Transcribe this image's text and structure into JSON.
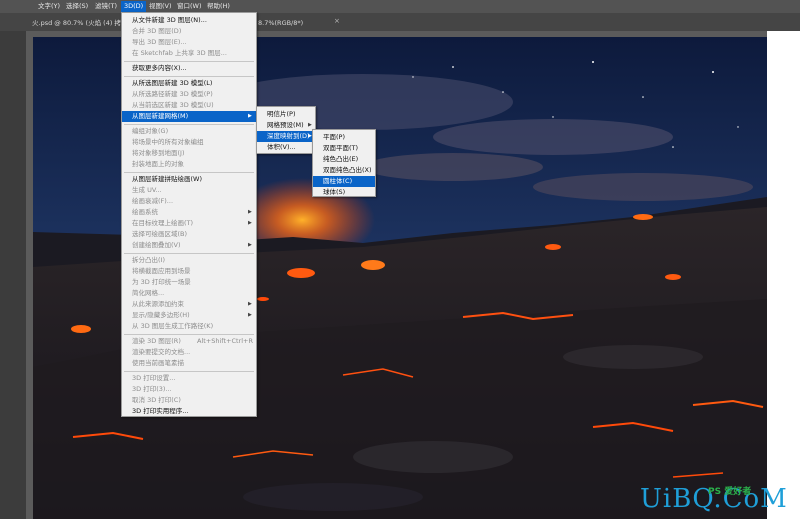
{
  "menubar": {
    "items": [
      "文字(Y)",
      "选择(S)",
      "滤镜(T)",
      "3D(D)",
      "视图(V)",
      "窗口(W)",
      "帮助(H)"
    ]
  },
  "tab": {
    "title": "火.psd @ 80.7% (火焰 (4) 拷",
    "title_tail": "8.7%(RGB/8*)",
    "close": "×"
  },
  "menu_3d": {
    "items": [
      {
        "label": "从文件新建 3D 图层(N)...",
        "disabled": false
      },
      {
        "label": "合并 3D 图层(D)",
        "disabled": true
      },
      {
        "label": "导出 3D 图层(E)...",
        "disabled": true
      },
      {
        "label": "在 Sketchfab 上共享 3D 图层...",
        "disabled": true
      },
      {
        "label": "获取更多内容(X)...",
        "disabled": false
      },
      {
        "label": "从所选图层新建 3D 模型(L)",
        "disabled": false
      },
      {
        "label": "从所选路径新建 3D 模型(P)",
        "disabled": true
      },
      {
        "label": "从当前选区新建 3D 模型(U)",
        "disabled": true
      },
      {
        "label": "从图层新建网格(M)",
        "disabled": false,
        "highlighted": true,
        "submenu": true
      },
      {
        "label": "编组对象(G)",
        "disabled": true
      },
      {
        "label": "将场景中的所有对象编组",
        "disabled": true
      },
      {
        "label": "将对象移到地面(J)",
        "disabled": true
      },
      {
        "label": "封装地面上的对象",
        "disabled": true
      },
      {
        "label": "从图层新建拼贴绘画(W)",
        "disabled": false
      },
      {
        "label": "生成 UV...",
        "disabled": true
      },
      {
        "label": "绘画衰减(F)...",
        "disabled": true
      },
      {
        "label": "绘画系统",
        "disabled": true,
        "submenu": true
      },
      {
        "label": "在目标纹理上绘画(T)",
        "disabled": true,
        "submenu": true
      },
      {
        "label": "选择可绘画区域(B)",
        "disabled": true
      },
      {
        "label": "创建绘图叠加(V)",
        "disabled": true,
        "submenu": true
      },
      {
        "label": "拆分凸出(I)",
        "disabled": true
      },
      {
        "label": "将横截面应用到场景",
        "disabled": true
      },
      {
        "label": "为 3D 打印统一场景",
        "disabled": true
      },
      {
        "label": "简化网格...",
        "disabled": true
      },
      {
        "label": "从此来源添加约束",
        "disabled": true,
        "submenu": true
      },
      {
        "label": "显示/隐藏多边形(H)",
        "disabled": true,
        "submenu": true
      },
      {
        "label": "从 3D 图层生成工作路径(K)",
        "disabled": true
      },
      {
        "label": "渲染 3D 图层(R)",
        "disabled": true,
        "shortcut": "Alt+Shift+Ctrl+R"
      },
      {
        "label": "渲染要提交的文档...",
        "disabled": true
      },
      {
        "label": "使用当前画笔素描",
        "disabled": true
      },
      {
        "label": "3D 打印设置...",
        "disabled": true
      },
      {
        "label": "3D 打印(3)...",
        "disabled": true
      },
      {
        "label": "取消 3D 打印(C)",
        "disabled": true
      },
      {
        "label": "3D 打印实用程序...",
        "disabled": false
      }
    ]
  },
  "submenu_mesh": {
    "items": [
      {
        "label": "明信片(P)",
        "submenu": false
      },
      {
        "label": "网格预设(M)",
        "submenu": true
      },
      {
        "label": "深度映射到(D)",
        "submenu": true,
        "highlighted": true
      },
      {
        "label": "体积(V)...",
        "submenu": false
      }
    ]
  },
  "submenu_depth": {
    "items": [
      {
        "label": "平面(P)"
      },
      {
        "label": "双面平面(T)"
      },
      {
        "label": "纯色凸出(E)"
      },
      {
        "label": "双面纯色凸出(X)"
      },
      {
        "label": "圆柱体(C)",
        "highlighted": true
      },
      {
        "label": "球体(S)"
      }
    ]
  },
  "watermark": {
    "text": "UiBQ.CoM",
    "sub": "PS 爱好者"
  },
  "colors": {
    "menu_bg": "#f0f0f0",
    "highlight": "#0a64c8",
    "menubar": "#535353",
    "lava": "#ff5a10"
  }
}
